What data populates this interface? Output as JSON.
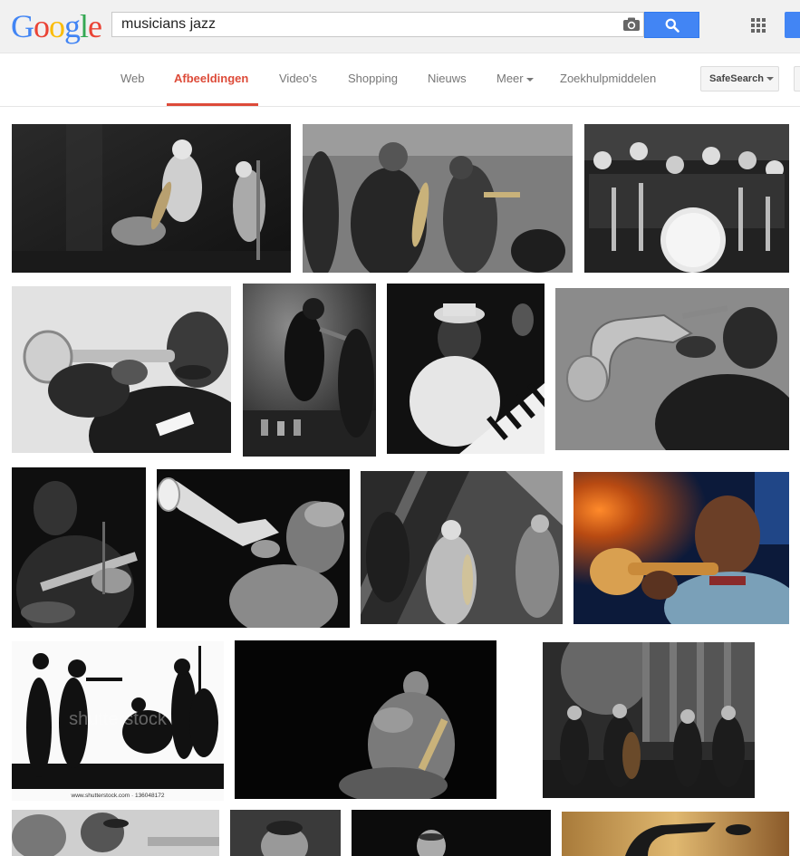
{
  "header": {
    "logo_letters": [
      {
        "ch": "G",
        "color": "#4285f4"
      },
      {
        "ch": "o",
        "color": "#ea4335"
      },
      {
        "ch": "o",
        "color": "#fbbc05"
      },
      {
        "ch": "g",
        "color": "#4285f4"
      },
      {
        "ch": "l",
        "color": "#34a853"
      },
      {
        "ch": "e",
        "color": "#ea4335"
      }
    ],
    "search_query": "musicians jazz",
    "accent": "#4285f4"
  },
  "nav": {
    "tabs": [
      {
        "label": "Web",
        "active": false
      },
      {
        "label": "Afbeeldingen",
        "active": true
      },
      {
        "label": "Video's",
        "active": false
      },
      {
        "label": "Shopping",
        "active": false
      },
      {
        "label": "Nieuws",
        "active": false
      },
      {
        "label": "Meer",
        "active": false
      },
      {
        "label": "Zoekhulpmiddelen",
        "active": false
      }
    ],
    "safesearch_label": "SafeSearch",
    "active_color": "#dd4b39"
  },
  "results": {
    "watermarks": {
      "shutterstock_url": "www.shutterstock.com · 136048172",
      "shutterstock_brand": "shutterstock"
    }
  }
}
